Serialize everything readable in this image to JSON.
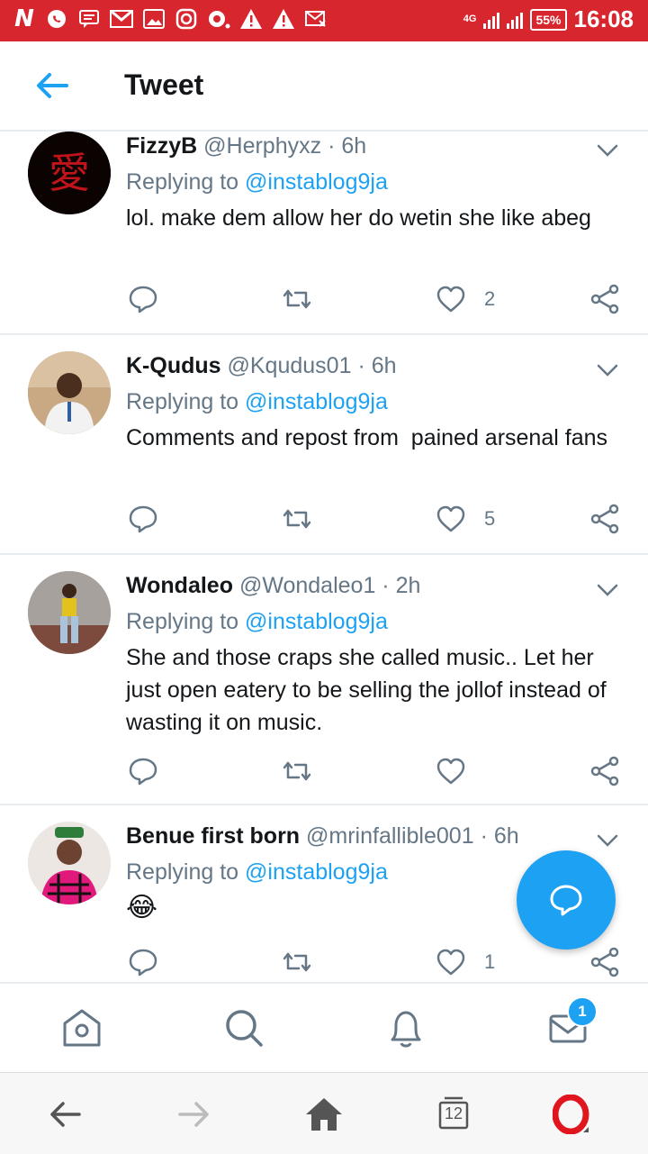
{
  "status_bar": {
    "network": "4G",
    "battery": "55%",
    "time": "16:08",
    "notification_icons": [
      "n-icon",
      "whatsapp-icon",
      "message-icon",
      "gmail-icon",
      "gallery-icon",
      "instagram-icon",
      "opera-icon",
      "warning-icon",
      "warning-icon",
      "sms-icon"
    ]
  },
  "header": {
    "title": "Tweet"
  },
  "tweets": [
    {
      "name": "FizzyB",
      "handle": "@Herphyxz",
      "time": "6h",
      "replying_prefix": "Replying to ",
      "replying_to": "@instablog9ja",
      "text": "lol. make dem allow her do wetin she like abeg",
      "likes": "2"
    },
    {
      "name": "K-Qudus",
      "handle": "@Kqudus01",
      "time": "6h",
      "replying_prefix": "Replying to ",
      "replying_to": "@instablog9ja",
      "text": "Comments and repost from  pained arsenal fans",
      "likes": "5"
    },
    {
      "name": "Wondaleo",
      "handle": "@Wondaleo1",
      "time": "2h",
      "replying_prefix": "Replying to ",
      "replying_to": "@instablog9ja",
      "text": "She and those craps she called music.. Let her just open eatery to be selling the jollof instead of wasting it on music.",
      "likes": ""
    },
    {
      "name": "Benue first born",
      "handle": "@mrinfallible001",
      "time": "6h",
      "replying_prefix": "Replying to ",
      "replying_to": "@instablog9ja",
      "text": "😂",
      "likes": "1"
    }
  ],
  "tab_bar": {
    "messages_badge": "1"
  },
  "browser_bar": {
    "tab_count": "12"
  },
  "colors": {
    "status_bar": "#d8262e",
    "accent": "#1da1f2",
    "secondary_text": "#657786",
    "divider": "#e6ecf0"
  }
}
